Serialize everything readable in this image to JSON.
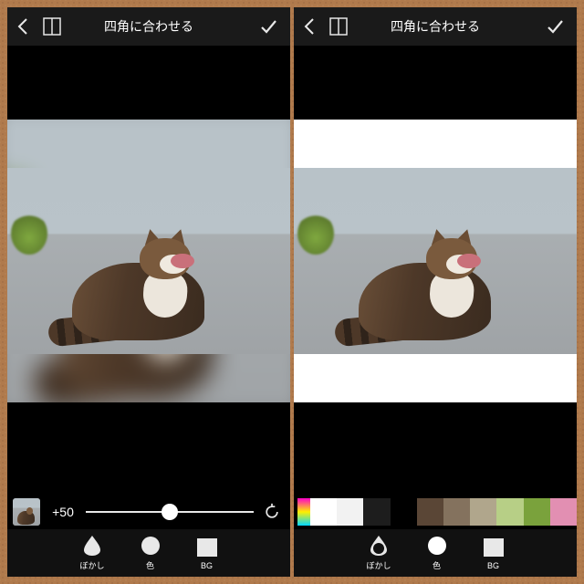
{
  "left": {
    "title": "四角に合わせる",
    "slider": {
      "value_label": "+50",
      "value_pct": 50
    },
    "tools": {
      "blur": {
        "label": "ぼかし",
        "active": true
      },
      "color": {
        "label": "色",
        "active": false
      },
      "bg": {
        "label": "BG",
        "active": false
      }
    },
    "background_mode": "blur"
  },
  "right": {
    "title": "四角に合わせる",
    "palette": [
      "#ffffff",
      "#f2f2f2",
      "#1d1d1d",
      "#000000",
      "#5a4636",
      "#84725e",
      "#b0a68c",
      "#b7cf86",
      "#7aa23c",
      "#e28fb2"
    ],
    "tools": {
      "blur": {
        "label": "ぼかし",
        "active": false
      },
      "color": {
        "label": "色",
        "active": true
      },
      "bg": {
        "label": "BG",
        "active": false
      }
    },
    "background_mode": "color",
    "background_color": "#ffffff"
  }
}
